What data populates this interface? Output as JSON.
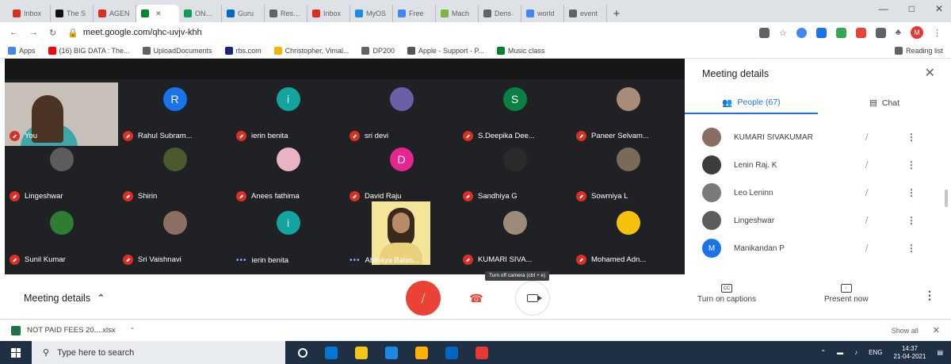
{
  "browser": {
    "tabs": [
      {
        "label": "Inbox",
        "icon": "gmail-icon",
        "color": "#d93025"
      },
      {
        "label": "The S",
        "icon": "r-icon",
        "color": "#111111"
      },
      {
        "label": "AGEN",
        "icon": "gmail-icon",
        "color": "#d93025"
      },
      {
        "label": "",
        "icon": "meet-icon",
        "color": "#00832d",
        "active": true
      },
      {
        "label": "ONLIN",
        "icon": "sheets-icon",
        "color": "#0f9d58"
      },
      {
        "label": "Guru",
        "icon": "linkedin-icon",
        "color": "#0a66c2"
      },
      {
        "label": "Resum",
        "icon": "globe-icon",
        "color": "#5f6368"
      },
      {
        "label": "Inbox",
        "icon": "gmail-icon",
        "color": "#d93025"
      },
      {
        "label": "MyOS",
        "icon": "box-icon",
        "color": "#1e88e5"
      },
      {
        "label": "Free",
        "icon": "google-icon",
        "color": "#4285f4"
      },
      {
        "label": "Mach",
        "icon": "flask-icon",
        "color": "#7cb342"
      },
      {
        "label": "Dens",
        "icon": "circle-icon",
        "color": "#5f6368"
      },
      {
        "label": "world",
        "icon": "google-icon",
        "color": "#4285f4"
      },
      {
        "label": "event",
        "icon": "globe-icon",
        "color": "#5f6368"
      }
    ],
    "url": "meet.google.com/qhc-uvjv-khh",
    "profile_initial": "M",
    "bookmarks": [
      {
        "label": "Apps",
        "color": "#4285f4"
      },
      {
        "label": "(16) BIG DATA : The...",
        "color": "#ff0000"
      },
      {
        "label": "UploadDocuments",
        "color": "#5f6368"
      },
      {
        "label": "rbs.com",
        "color": "#1a237e"
      },
      {
        "label": "Christopher, Vimal...",
        "color": "#f4b400"
      },
      {
        "label": "DP200",
        "color": "#5f6368"
      },
      {
        "label": "Apple - Support - P...",
        "color": "#555555"
      },
      {
        "label": "Music class",
        "color": "#00832d"
      }
    ],
    "reading_list": "Reading list"
  },
  "meeting": {
    "tiles": [
      {
        "name": "You",
        "type": "self",
        "muted": true
      },
      {
        "name": "Rahul Subram...",
        "type": "letter",
        "letter": "R",
        "color": "#1a73e8",
        "muted": true
      },
      {
        "name": "ierin benita",
        "type": "letter",
        "letter": "i",
        "color": "#12a5a0",
        "muted": true
      },
      {
        "name": "sri devi",
        "type": "photo",
        "color": "#6d5ea8",
        "muted": true
      },
      {
        "name": "S.Deepika Dee...",
        "type": "letter",
        "letter": "S",
        "color": "#0b8043",
        "muted": true
      },
      {
        "name": "Paneer Selvam...",
        "type": "photo",
        "color": "#a98b79",
        "muted": true
      },
      {
        "name": "Lingeshwar",
        "type": "photo",
        "color": "#5c5c5c",
        "muted": true
      },
      {
        "name": "Shirin",
        "type": "photo",
        "color": "#4a5a2e",
        "muted": true
      },
      {
        "name": "Anees fathima",
        "type": "photo",
        "color": "#e8b4c4",
        "muted": true
      },
      {
        "name": "David Raju",
        "type": "letter",
        "letter": "D",
        "color": "#e52592",
        "muted": true
      },
      {
        "name": "Sandhiya G",
        "type": "photo",
        "color": "#2a2a2a",
        "muted": true
      },
      {
        "name": "Sowmiya L",
        "type": "photo",
        "color": "#7a6a5a",
        "muted": true
      },
      {
        "name": "Sunil Kumar",
        "type": "photo",
        "color": "#2e7d32",
        "muted": true
      },
      {
        "name": "Sri Vaishnavi",
        "type": "photo",
        "color": "#8d6e63",
        "muted": true
      },
      {
        "name": "ierin benita",
        "type": "letter",
        "letter": "i",
        "color": "#12a5a0",
        "muted": false
      },
      {
        "name": "Abinaya Balas...",
        "type": "camera",
        "muted": false
      },
      {
        "name": "KUMARI SIVA...",
        "type": "photo",
        "color": "#9e8a7a",
        "muted": true
      },
      {
        "name": "Mohamed Adn...",
        "type": "photo",
        "color": "#f4c20d",
        "muted": true
      }
    ]
  },
  "panel": {
    "title": "Meeting details",
    "people_tab": "People (67)",
    "chat_tab": "Chat",
    "people": [
      {
        "name": "KUMARI SIVAKUMAR",
        "type": "photo",
        "color": "#8a6e62"
      },
      {
        "name": "Lenin Raj. K",
        "type": "photo",
        "color": "#3c3c3c"
      },
      {
        "name": "Leo Leninn",
        "type": "photo",
        "color": "#7a7a7a"
      },
      {
        "name": "Lingeshwar",
        "type": "photo",
        "color": "#5c5c5c"
      },
      {
        "name": "Manikandan P",
        "type": "letter",
        "letter": "M",
        "color": "#1a73e8"
      }
    ]
  },
  "controls": {
    "meeting_details": "Meeting details",
    "camera_tooltip": "Turn off camera (ctrl + e)",
    "captions_label": "Turn on captions",
    "present_label": "Present now",
    "captions_glyph": "CC"
  },
  "download": {
    "file": "NOT PAID FEES 20....xlsx",
    "show_all": "Show all"
  },
  "taskbar": {
    "search_placeholder": "Type here to search",
    "apps": [
      "#ffffff",
      "#0078d4",
      "#f5c518",
      "#1e88e5",
      "#ffb300",
      "#0067c0",
      "#e53935"
    ],
    "lang": "ENG",
    "time": "14:37",
    "date": "21-04-2021"
  }
}
